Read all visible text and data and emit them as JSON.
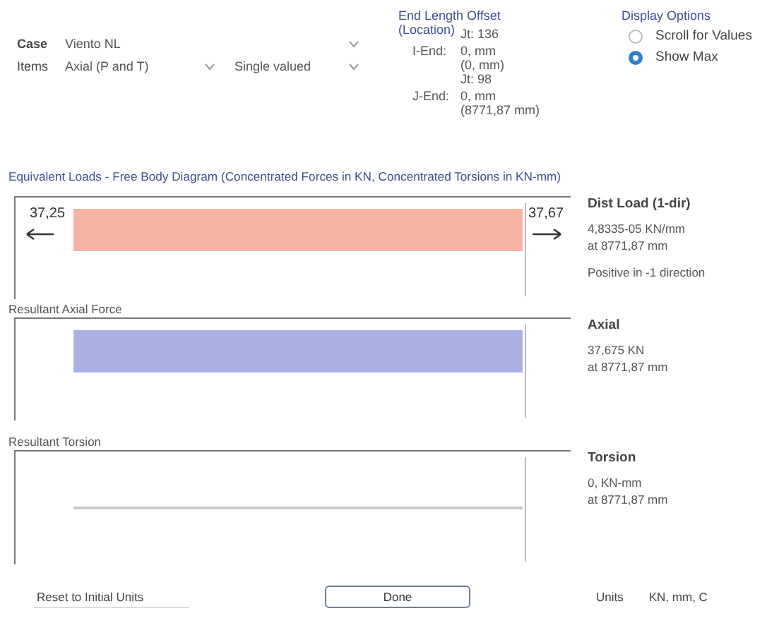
{
  "case": {
    "label": "Case",
    "value": "Viento NL"
  },
  "items": {
    "label": "Items",
    "component": "Axial (P and T)",
    "mode": "Single valued"
  },
  "end_length_offset": {
    "title": "End Length Offset",
    "subtitle": "(Location)",
    "ends": [
      {
        "joint": "Jt: 136",
        "label": "I-End:",
        "offset": "0, mm",
        "location": "(0, mm)"
      },
      {
        "joint": "Jt: 98",
        "label": "J-End:",
        "offset": "0, mm",
        "location": "(8771,87 mm)"
      }
    ]
  },
  "display_options": {
    "title": "Display Options",
    "options": [
      {
        "label": "Scroll for Values",
        "selected": false
      },
      {
        "label": "Show Max",
        "selected": true
      }
    ]
  },
  "diagram_title": "Equivalent Loads - Free Body Diagram  (Concentrated Forces in KN, Concentrated Torsions in KN-mm)",
  "panels": [
    {
      "kind": "load",
      "color": "#f5b3a3",
      "left_value": "37,25",
      "right_value": "37,67",
      "info": {
        "heading": "Dist Load (1-dir)",
        "lines": [
          "4,8335-05 KN/mm",
          "at 8771,87 mm"
        ],
        "note": "Positive in -1 direction"
      }
    },
    {
      "kind": "bar",
      "title": "Resultant Axial Force",
      "color": "#a9b0e2",
      "info": {
        "heading": "Axial",
        "lines": [
          "37,675 KN",
          "at 8771,87 mm"
        ]
      }
    },
    {
      "kind": "line",
      "title": "Resultant Torsion",
      "info": {
        "heading": "Torsion",
        "lines": [
          "0, KN-mm",
          "at 8771,87 mm"
        ]
      }
    }
  ],
  "footer": {
    "reset": "Reset to Initial Units",
    "done": "Done",
    "units_label": "Units",
    "units_value": "KN, mm, C"
  }
}
